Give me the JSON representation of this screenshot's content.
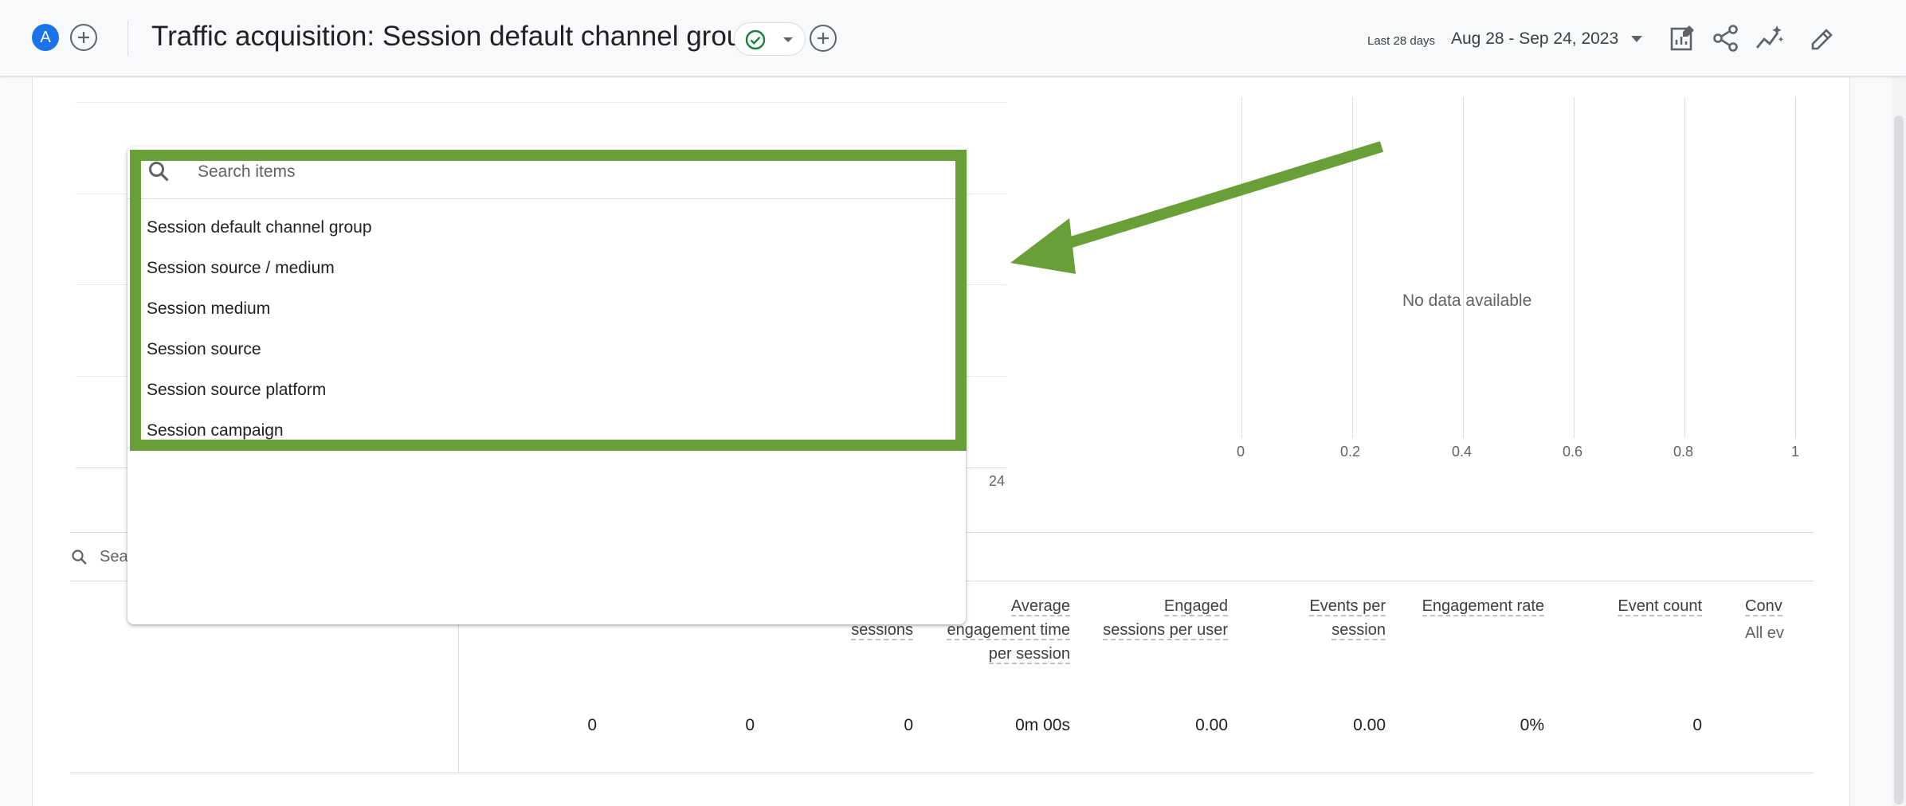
{
  "header": {
    "avatar_letter": "A",
    "title": "Traffic acquisition: Session default channel group",
    "date_label": "Last 28 days",
    "date_range": "Aug 28 - Sep 24, 2023"
  },
  "icons": {
    "add": "plus-icon",
    "status": "check-circle-icon",
    "caret": "caret-down-icon",
    "customize": "customize-report-icon",
    "share": "share-icon",
    "insights": "insights-icon",
    "edit": "pencil-icon",
    "search": "search-icon"
  },
  "colors": {
    "accent_blue": "#1a73e8",
    "highlight_green": "#68a037",
    "status_green": "#188038"
  },
  "chart": {
    "left_x_tick": "24",
    "no_data_text": "No data available",
    "right_x_ticks": [
      "0",
      "0.2",
      "0.4",
      "0.6",
      "0.8",
      "1"
    ]
  },
  "table": {
    "search_placeholder_fragment": "Sear",
    "columns": [
      {
        "label": "sessions"
      },
      {
        "label": "Average engagement time per session"
      },
      {
        "label": "Engaged sessions per user"
      },
      {
        "label": "Events per session"
      },
      {
        "label": "Engagement rate"
      },
      {
        "label": "Event count"
      },
      {
        "label": "Conv",
        "sub": "All ev"
      }
    ],
    "totals": [
      "0",
      "0",
      "0",
      "0m 00s",
      "0.00",
      "0.00",
      "0%",
      "0"
    ]
  },
  "dropdown": {
    "search_placeholder": "Search items",
    "items": [
      "Session default channel group",
      "Session source / medium",
      "Session medium",
      "Session source",
      "Session source platform",
      "Session campaign"
    ]
  }
}
